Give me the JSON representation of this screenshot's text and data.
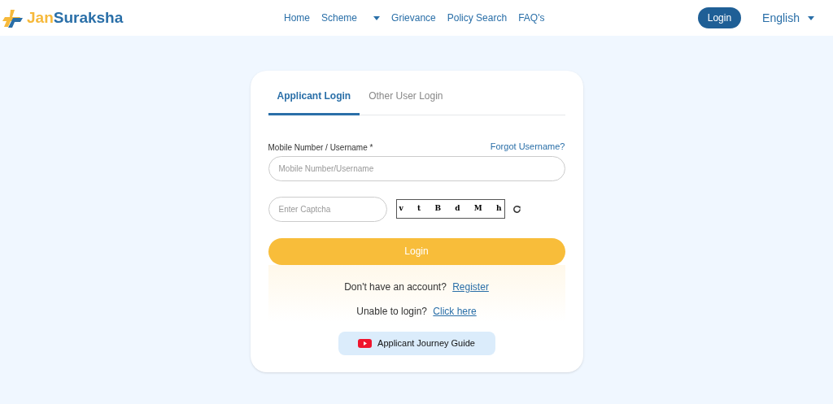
{
  "header": {
    "logo_parts": [
      "Jan",
      "Suraksha"
    ],
    "nav": [
      {
        "label": "Home",
        "kind": "link"
      },
      {
        "label": "Scheme",
        "kind": "menu"
      },
      {
        "label": "Grievance",
        "kind": "link"
      },
      {
        "label": "Policy Search",
        "kind": "link"
      },
      {
        "label": "FAQ's",
        "kind": "link"
      }
    ],
    "login_button": "Login",
    "language": "English"
  },
  "tabs": [
    {
      "label": "Applicant Login",
      "selected": true
    },
    {
      "label": "Other User Login",
      "selected": false
    }
  ],
  "username": {
    "label": "Mobile Number / Username *",
    "forgot_link": "Forgot Username?",
    "placeholder": "Mobile Number/Username"
  },
  "captcha": {
    "placeholder": "Enter Captcha",
    "characters": [
      "v",
      "t",
      "B",
      "d",
      "M",
      "h"
    ]
  },
  "login_button": "Login",
  "register": {
    "text": "Don't have an account?",
    "link": "Register"
  },
  "help": {
    "text": "Unable to login?",
    "link": "Click here"
  },
  "guide_button": "Applicant Journey Guide"
}
